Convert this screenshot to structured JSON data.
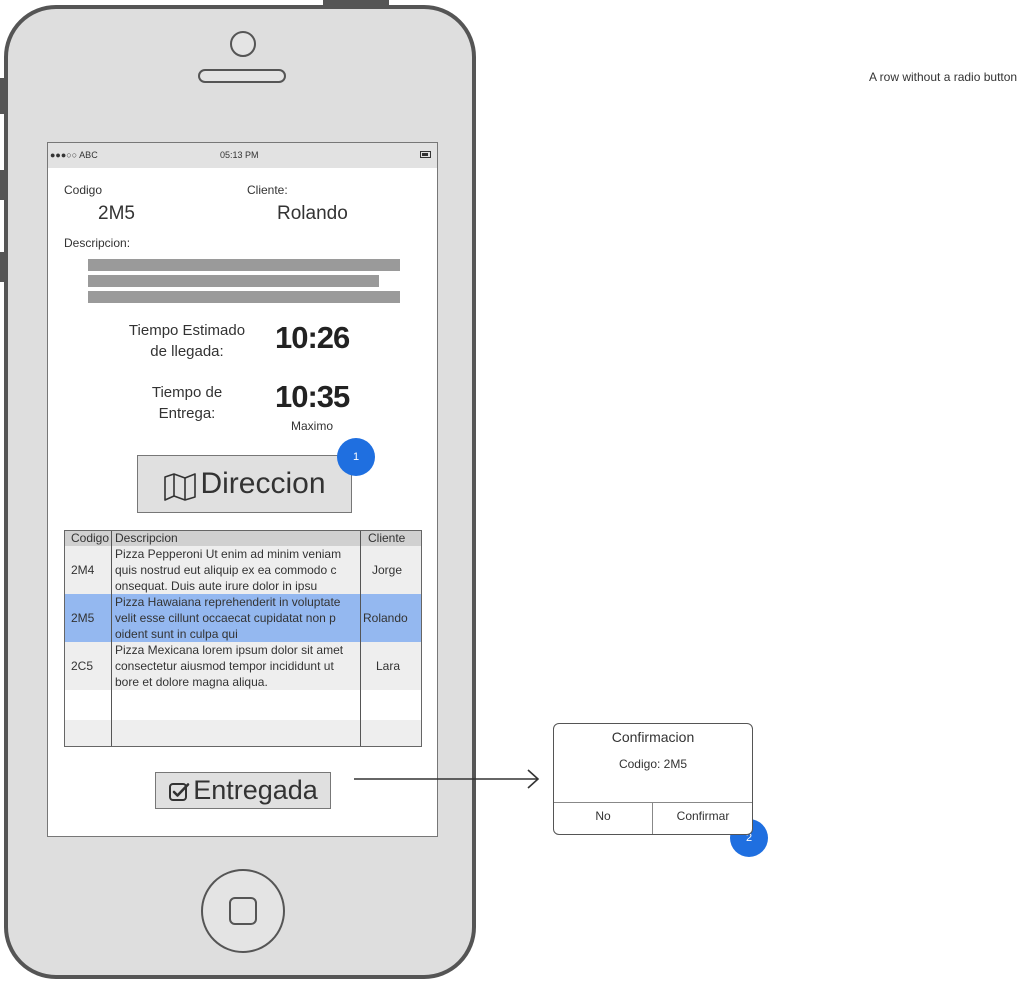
{
  "status_bar": {
    "carrier": "●●●○○ ABC",
    "time": "05:13 PM"
  },
  "order": {
    "codigo_label": "Codigo",
    "codigo_value": "2M5",
    "cliente_label": "Cliente:",
    "cliente_value": "Rolando",
    "descripcion_label": "Descripcion:"
  },
  "tiempo_estimado": {
    "label_line1": "Tiempo Estimado",
    "label_line2": "de llegada:",
    "value": "10:26"
  },
  "tiempo_entrega": {
    "label_line1": "Tiempo de",
    "label_line2": "Entrega:",
    "value": "10:35",
    "caption": "Maximo"
  },
  "direccion_button": {
    "label": "Direccion",
    "icon": "map-icon"
  },
  "table": {
    "headers": [
      "Codigo",
      "Descripcion",
      "Cliente"
    ],
    "rows": [
      {
        "codigo": "2M4",
        "descripcion": [
          "Pizza Pepperoni Ut enim ad minim veniam",
          "quis nostrud eut aliquip ex ea commodo c",
          "onsequat. Duis aute irure dolor in  ipsu"
        ],
        "cliente": "Jorge",
        "selected": false
      },
      {
        "codigo": "2M5",
        "descripcion": [
          "Pizza Hawaiana reprehenderit in voluptate",
          "velit esse cillunt occaecat cupidatat non p",
          "oident sunt in culpa qui"
        ],
        "cliente": "Rolando",
        "selected": true
      },
      {
        "codigo": "2C5",
        "descripcion": [
          "Pizza Mexicana lorem ipsum dolor sit amet",
          "consectetur aiusmod tempor incididunt ut",
          "bore et dolore magna aliqua."
        ],
        "cliente": "Lara",
        "selected": false
      }
    ]
  },
  "entregada_button": {
    "label": "Entregada",
    "icon": "checkbox-icon"
  },
  "badges": {
    "one": "1",
    "two": "2"
  },
  "dialog": {
    "title": "Confirmacion",
    "message": "Codigo: 2M5",
    "no_label": "No",
    "confirm_label": "Confirmar"
  },
  "note": "A row without a radio button",
  "colors": {
    "selected_row": "#94b8f0",
    "badge": "#1f6fe0",
    "frame": "#555555"
  }
}
